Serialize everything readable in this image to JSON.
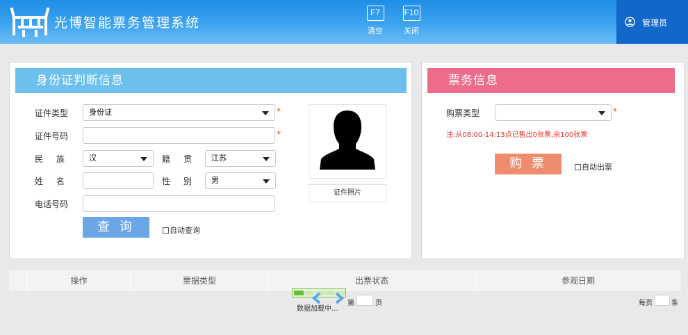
{
  "header": {
    "app_title": "光博智能票务管理系统",
    "hotkeys": [
      {
        "key": "F7",
        "label": "清空"
      },
      {
        "key": "F10",
        "label": "关闭"
      }
    ],
    "user": {
      "name": "管理员",
      "icon": "user-icon"
    }
  },
  "id_panel": {
    "title": "身份证判断信息",
    "fields": {
      "id_type": {
        "label": "证件类型",
        "value": "身份证"
      },
      "id_number": {
        "label": "证件号码",
        "value": ""
      },
      "ethnicity": {
        "label": "民族",
        "value": "汉"
      },
      "native_place": {
        "label": "籍贯",
        "value": "江苏"
      },
      "name": {
        "label": "姓名",
        "value": ""
      },
      "gender": {
        "label": "性别",
        "value": "男"
      },
      "phone": {
        "label": "电话号码",
        "value": ""
      }
    },
    "photo_label": "证件照片",
    "query_button": "查 询",
    "auto_query": "自动查询",
    "required_mark": "*"
  },
  "ticket_panel": {
    "title": "票务信息",
    "ticket_type": {
      "label": "购票类型",
      "value": ""
    },
    "notice": "注:从08:00-14:13点已售出0张票,余100张票",
    "buy_button": "购 票",
    "auto_issue": "自动出票",
    "required_mark": "*"
  },
  "table": {
    "columns": [
      "操作",
      "票据类型",
      "出票状态",
      "参观日期"
    ]
  },
  "pager": {
    "loading_text": "数据加载中...",
    "page_prefix": "第",
    "page_suffix": "页",
    "per_page_prefix": "每页",
    "per_page_suffix": "条"
  },
  "colors": {
    "header_blue": "#2a97ea",
    "user_area": "#1168c9",
    "id_title_bg": "#6dbfec",
    "ticket_title_bg": "#ec6c8a",
    "query_button": "#6ba6e6",
    "buy_button": "#ef8c6e",
    "notice_red": "#e8332c"
  }
}
